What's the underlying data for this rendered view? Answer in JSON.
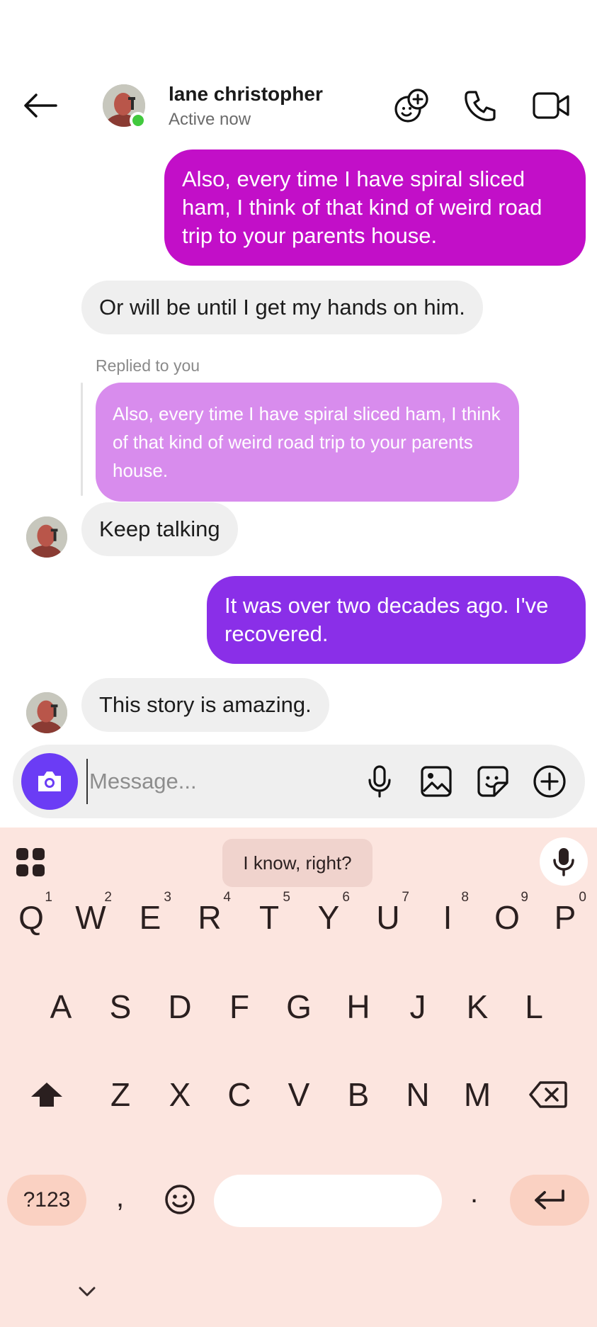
{
  "header": {
    "contact_name": "lane christopher",
    "status": "Active now",
    "status_color": "#41c93d",
    "icons": [
      "back-arrow-icon",
      "add-effects-icon",
      "phone-icon",
      "video-call-icon"
    ]
  },
  "messages": [
    {
      "direction": "outgoing",
      "text": "Also, every time I have spiral sliced ham, I think of that kind of weird road trip to your parents house.",
      "color": "#c20fc8"
    },
    {
      "direction": "incoming",
      "text": "Or will be until I get my hands on him."
    },
    {
      "direction": "incoming",
      "reply_label": "Replied to you",
      "quoted_text": "Also, every time I have spiral sliced ham, I think of that kind of weird road trip to your parents house.",
      "quote_color": "#d88ced"
    },
    {
      "direction": "incoming",
      "text": "Keep talking"
    },
    {
      "direction": "outgoing",
      "text": "It was over two decades ago. I've recovered.",
      "color": "#8a2fe8"
    },
    {
      "direction": "incoming",
      "text": "This story is amazing."
    }
  ],
  "composer": {
    "placeholder": "Message...",
    "value": "",
    "camera_color": "#6b3cf5",
    "icons": [
      "camera-icon",
      "microphone-icon",
      "gallery-icon",
      "sticker-icon",
      "plus-icon"
    ]
  },
  "keyboard": {
    "suggestion": "I know, right?",
    "row1": [
      {
        "key": "Q",
        "hint": "1"
      },
      {
        "key": "W",
        "hint": "2"
      },
      {
        "key": "E",
        "hint": "3"
      },
      {
        "key": "R",
        "hint": "4"
      },
      {
        "key": "T",
        "hint": "5"
      },
      {
        "key": "Y",
        "hint": "6"
      },
      {
        "key": "U",
        "hint": "7"
      },
      {
        "key": "I",
        "hint": "8"
      },
      {
        "key": "O",
        "hint": "9"
      },
      {
        "key": "P",
        "hint": "0"
      }
    ],
    "row2": [
      "A",
      "S",
      "D",
      "F",
      "G",
      "H",
      "J",
      "K",
      "L"
    ],
    "row3": [
      "Z",
      "X",
      "C",
      "V",
      "B",
      "N",
      "M"
    ],
    "symbols_label": "?123",
    "comma": ",",
    "period": ".",
    "background": "#fce5df",
    "accent_key_color": "#fad1c2"
  }
}
